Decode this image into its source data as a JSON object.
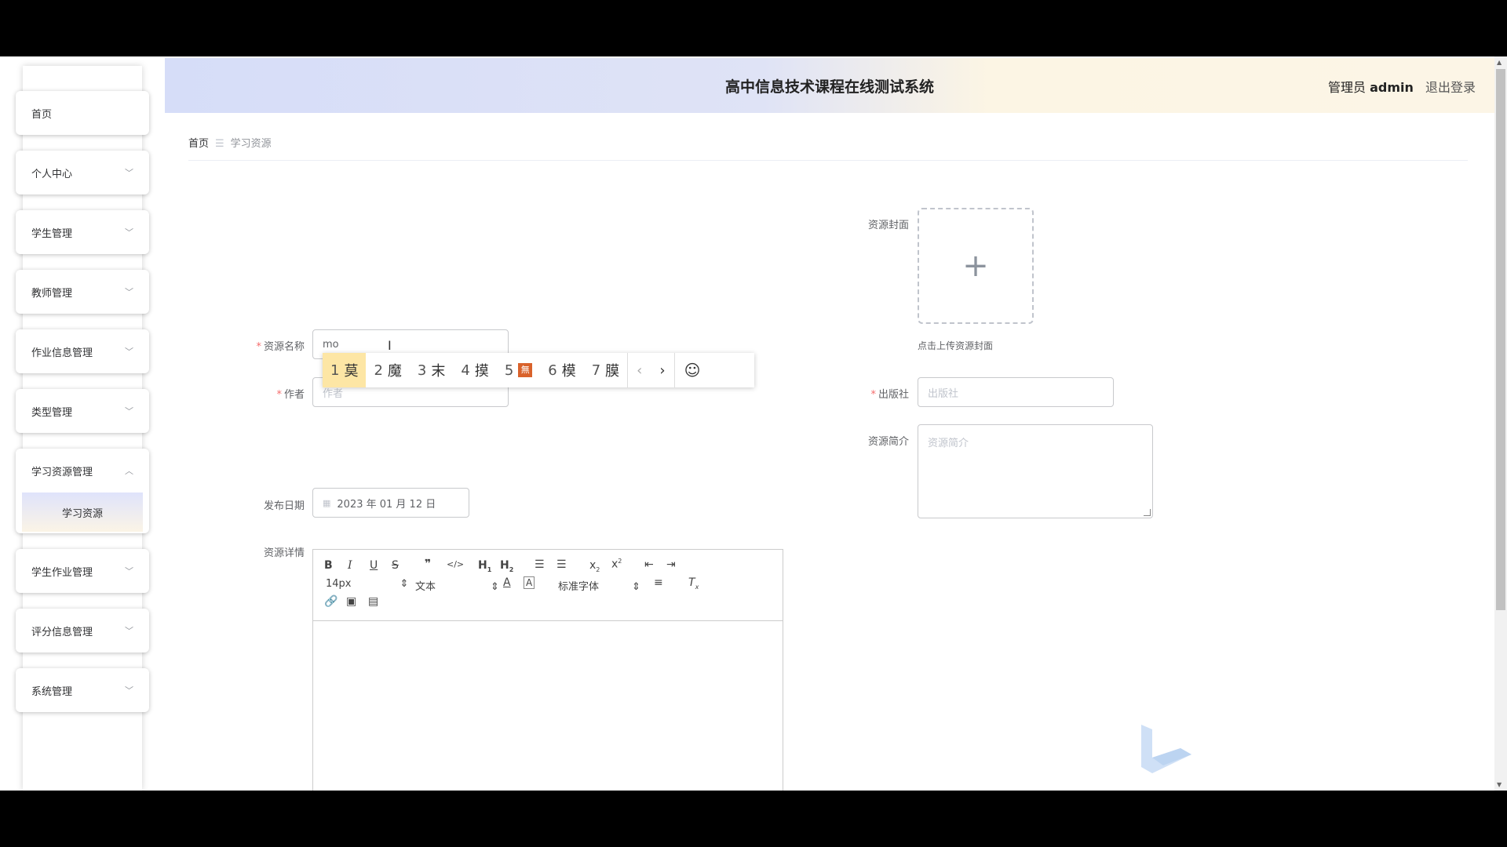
{
  "header": {
    "title": "高中信息技术课程在线测试系统",
    "role": "管理员",
    "user": "admin",
    "logout": "退出登录"
  },
  "sidebar": {
    "items": [
      {
        "label": "首页"
      },
      {
        "label": "个人中心",
        "chevron": "﹀"
      },
      {
        "label": "学生管理",
        "chevron": "﹀"
      },
      {
        "label": "教师管理",
        "chevron": "﹀"
      },
      {
        "label": "作业信息管理",
        "chevron": "﹀"
      },
      {
        "label": "类型管理",
        "chevron": "﹀"
      },
      {
        "label": "学习资源管理",
        "chevron": "︿",
        "sub": "学习资源"
      },
      {
        "label": "学生作业管理",
        "chevron": "﹀"
      },
      {
        "label": "评分信息管理",
        "chevron": "﹀"
      },
      {
        "label": "系统管理",
        "chevron": "﹀"
      }
    ]
  },
  "breadcrumb": {
    "home": "首页",
    "sep": "☰",
    "current": "学习资源"
  },
  "form": {
    "cover_label": "资源封面",
    "cover_tip": "点击上传资源封面",
    "name_label": "资源名称",
    "name_value": "mo",
    "author_label": "作者",
    "author_placeholder": "作者",
    "publisher_label": "出版社",
    "publisher_placeholder": "出版社",
    "intro_label": "资源简介",
    "intro_placeholder": "资源简介",
    "date_label": "发布日期",
    "date_value": "2023 年 01 月 12 日",
    "detail_label": "资源详情",
    "required_mark": "*"
  },
  "editor": {
    "font_size": "14px",
    "block": "文本",
    "font_family": "标准字体"
  },
  "ime": {
    "candidates": [
      {
        "n": "1",
        "c": "莫"
      },
      {
        "n": "2",
        "c": "魔"
      },
      {
        "n": "3",
        "c": "末"
      },
      {
        "n": "4",
        "c": "摸"
      },
      {
        "n": "5",
        "c": "無"
      },
      {
        "n": "6",
        "c": "模"
      },
      {
        "n": "7",
        "c": "膜"
      }
    ]
  }
}
